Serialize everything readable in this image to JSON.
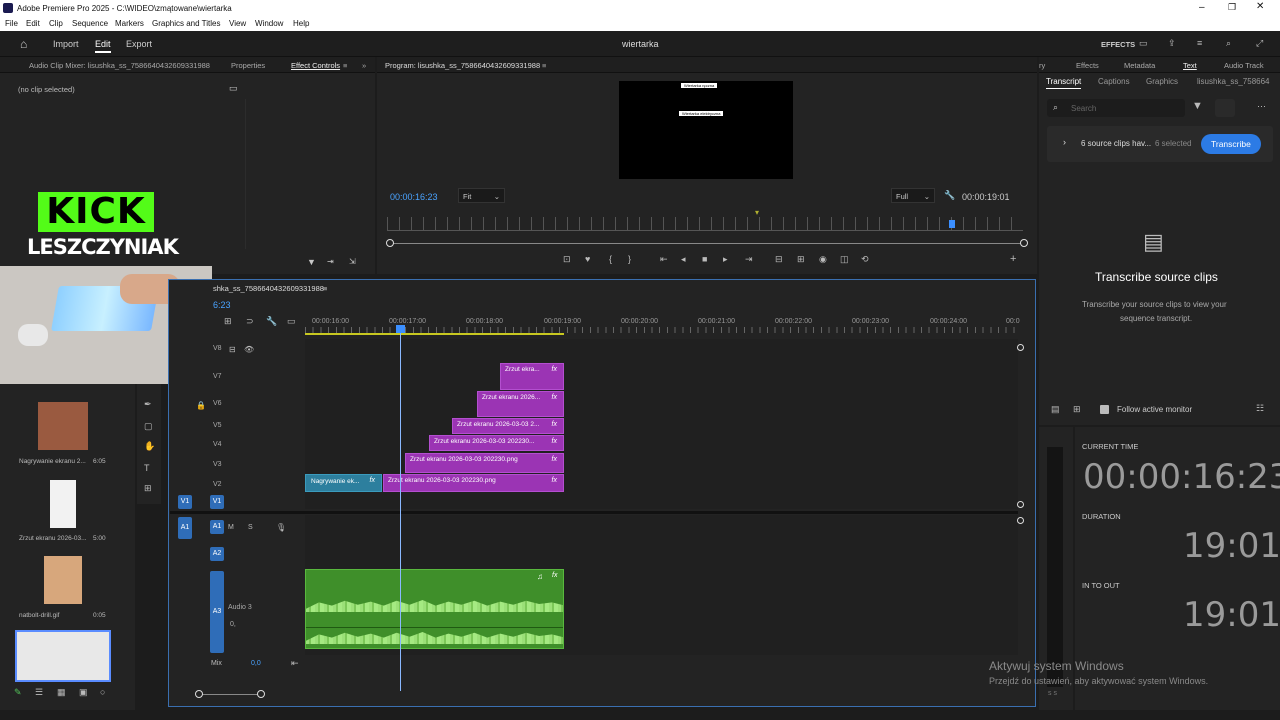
{
  "window": {
    "title": "Adobe Premiere Pro 2025 - C:\\WIDEO\\zmątowane\\wiertarka"
  },
  "menu": [
    "File",
    "Edit",
    "Clip",
    "Sequence",
    "Markers",
    "Graphics and Titles",
    "View",
    "Window",
    "Help"
  ],
  "topbar": {
    "import": "Import",
    "edit": "Edit",
    "export": "Export",
    "project": "wiertarka",
    "effects": "EFFECTS"
  },
  "left_panel": {
    "tabs": [
      "Audio Clip Mixer: lisushka_ss_7586640432609331988",
      "Properties",
      "Effect Controls"
    ],
    "no_clip": "(no clip selected)"
  },
  "overlay": {
    "kick": "KICK",
    "name": "LESZCZYNIAK"
  },
  "program": {
    "title": "Program: lisushka_ss_7586640432609331988",
    "current_time": "00:00:16:23",
    "fit": "Fit",
    "quality": "Full",
    "duration": "00:00:19:01",
    "screen_text1": "Wiertarka ręczna",
    "screen_text2": "Wiertarka elektryczna"
  },
  "right_panel": {
    "tabs": [
      "Effects",
      "Metadata",
      "Text",
      "Audio Track"
    ],
    "subtabs": [
      "Transcript",
      "Captions",
      "Graphics",
      "lisushka_ss_758664"
    ],
    "search_placeholder": "Search",
    "source_clips": "6 source clips hav...",
    "selected": "6 selected",
    "transcribe_btn": "Transcribe",
    "heading": "Transcribe source clips",
    "desc1": "Transcribe your source clips to view your",
    "desc2": "sequence transcript.",
    "follow": "Follow active monitor"
  },
  "timepanel": {
    "current_label": "CURRENT TIME",
    "current": "00:00:16:23",
    "duration_label": "DURATION",
    "duration": "19:01",
    "inout_label": "IN TO OUT",
    "inout": "19:01"
  },
  "timeline": {
    "title": "shka_ss_7586640432609331988",
    "timecode": "6:23",
    "ruler": [
      "00:00:16:00",
      "00:00:17:00",
      "00:00:18:00",
      "00:00:19:00",
      "00:00:20:00",
      "00:00:21:00",
      "00:00:22:00",
      "00:00:23:00",
      "00:00:24:00",
      "00:0"
    ],
    "video_tracks": [
      "V8",
      "V7",
      "V6",
      "V5",
      "V4",
      "V3",
      "V2",
      "V1"
    ],
    "audio_tracks": [
      "A1",
      "A2",
      "A3"
    ],
    "audio3_name": "Audio 3",
    "mix": "Mix",
    "mix_val": "0,0",
    "a3_val": "0,",
    "clips": {
      "v7": "Zrzut ekra...",
      "v6": "Zrzut ekranu 2026...",
      "v5": "Zrzut ekranu 2026-03-03 2...",
      "v4": "Zrzut ekranu 2026-03-03 202230...",
      "v3": "Zrzut ekranu 2026-03-03 202230.png",
      "v2": "Zrzut ekranu 2026-03-03 202230.png",
      "v2_teal": "Nagrywanie ek...",
      "fx": "fx"
    }
  },
  "project_items": [
    {
      "label": "Nagrywanie ekranu 2...",
      "dur": "6:05"
    },
    {
      "label": "Zrzut ekranu 2026-03...",
      "dur": "5:00"
    },
    {
      "label": "natbolt-drill.gif",
      "dur": "0:05"
    }
  ],
  "watermark": {
    "line1": "Aktywuj system Windows",
    "line2": "Przejdź do ustawień, aby aktywować system Windows."
  }
}
